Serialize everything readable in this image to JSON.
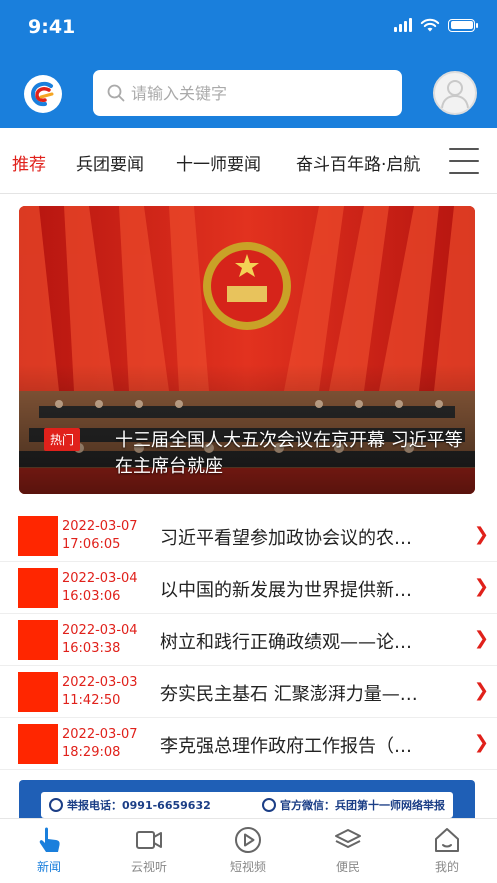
{
  "status": {
    "time": "9:41"
  },
  "header": {
    "search_placeholder": "请输入关键字"
  },
  "tabs": [
    {
      "label": "推荐",
      "active": true
    },
    {
      "label": "兵团要闻"
    },
    {
      "label": "十一师要闻"
    },
    {
      "label": "奋斗百年路·启航"
    }
  ],
  "banner": {
    "badge": "热门",
    "title": "十三届全国人大五次会议在京开幕 习近平等在主席台就座"
  },
  "news": [
    {
      "date": "2022-03-07",
      "time": "17:06:05",
      "title": "习近平看望参加政协会议的农…"
    },
    {
      "date": "2022-03-04",
      "time": "16:03:06",
      "title": "以中国的新发展为世界提供新…"
    },
    {
      "date": "2022-03-04",
      "time": "16:03:38",
      "title": "树立和践行正确政绩观——论…"
    },
    {
      "date": "2022-03-03",
      "time": "11:42:50",
      "title": "夯实民主基石 汇聚澎湃力量—…"
    },
    {
      "date": "2022-03-07",
      "time": "18:29:08",
      "title": "李克强总理作政府工作报告（…"
    }
  ],
  "ad": {
    "phone": "举报电话：0991-6659632",
    "wechat": "官方微信：兵团第十一师网络举报"
  },
  "tabbar": [
    {
      "label": "新闻",
      "icon": "news-icon",
      "active": true
    },
    {
      "label": "云视听",
      "icon": "video-icon"
    },
    {
      "label": "短视频",
      "icon": "play-icon"
    },
    {
      "label": "便民",
      "icon": "layers-icon"
    },
    {
      "label": "我的",
      "icon": "home-icon"
    }
  ],
  "colors": {
    "primary": "#1a7fdc",
    "accent": "#e0211b"
  }
}
